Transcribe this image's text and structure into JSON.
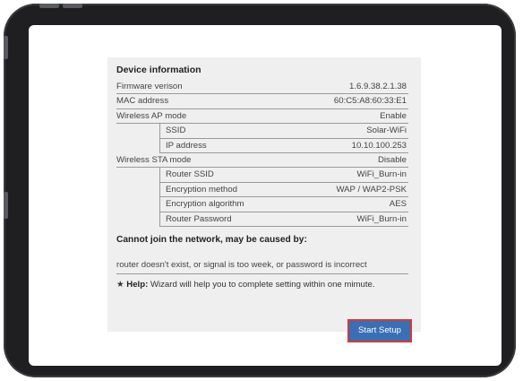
{
  "device_info": {
    "heading": "Device information",
    "rows": [
      {
        "label": "Firmware verison",
        "value": "1.6.9.38.2.1.38"
      },
      {
        "label": "MAC address",
        "value": "60:C5:A8:60:33:E1"
      },
      {
        "label": "Wireless AP mode",
        "value": "Enable"
      },
      {
        "label": "SSID",
        "value": "Solar-WiFi"
      },
      {
        "label": "IP address",
        "value": "10.10.100.253"
      },
      {
        "label": "Wireless STA mode",
        "value": "Disable"
      },
      {
        "label": "Router SSID",
        "value": "WiFi_Burn-in"
      },
      {
        "label": "Encryption method",
        "value": "WAP / WAP2-PSK"
      },
      {
        "label": "Encryption algorithm",
        "value": "AES"
      },
      {
        "label": "Router Password",
        "value": "WiFi_Burn-in"
      }
    ]
  },
  "troubleshoot": {
    "heading": "Cannot join the network, may be caused by:",
    "reason": "router doesn't exist, or signal is too week, or password is incorrect"
  },
  "help": {
    "star": "★",
    "label": "Help:",
    "text": "Wizard will help you to complete setting within one mimute."
  },
  "buttons": {
    "start_setup": "Start Setup"
  },
  "colors": {
    "button_bg": "#3a6fb5",
    "button_border": "#d23a3a",
    "panel_bg": "#efefef",
    "bezel": "#1f1f21"
  }
}
